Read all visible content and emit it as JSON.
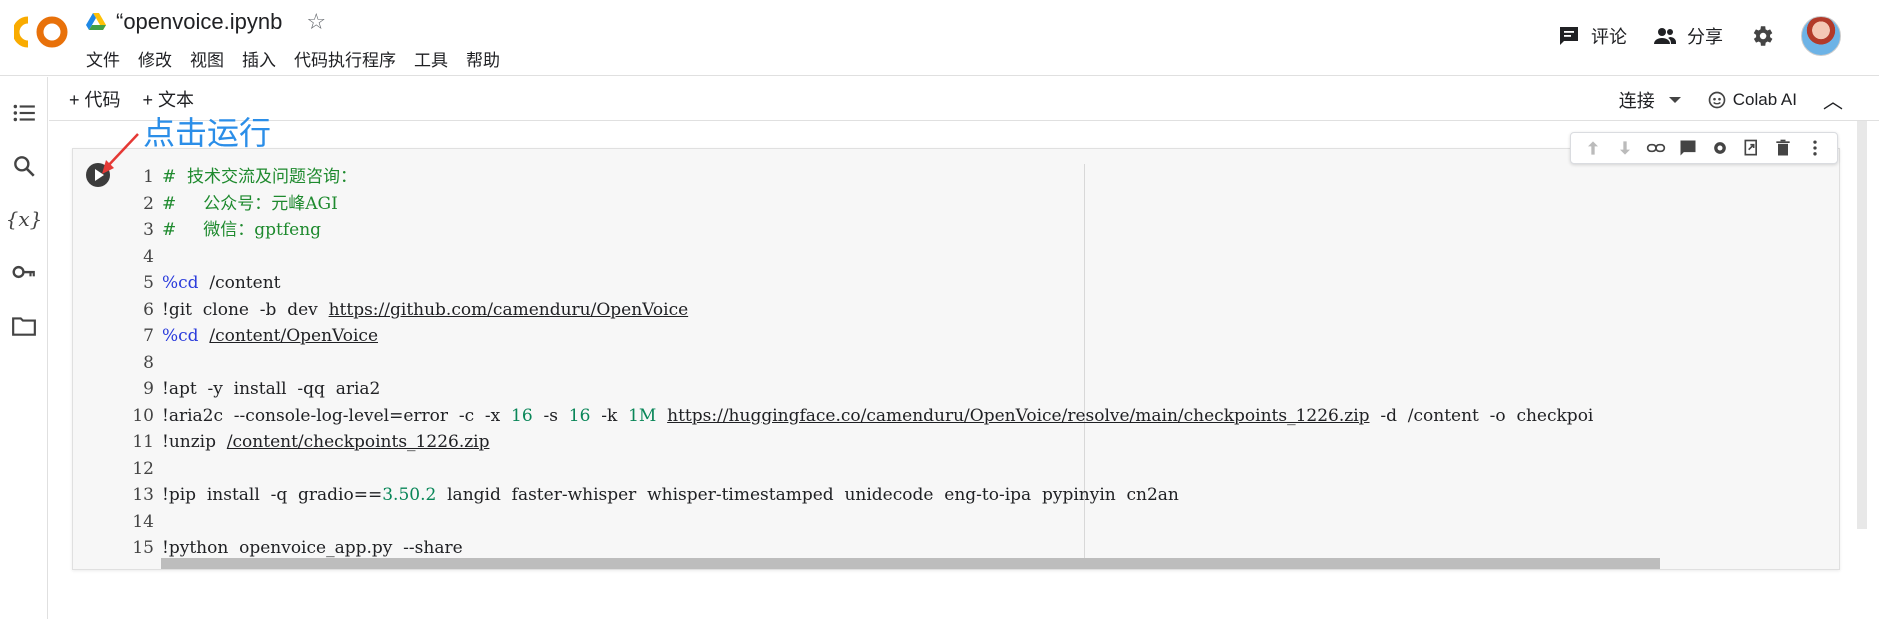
{
  "header": {
    "doc_title": "“openvoice.ipynb",
    "menu": [
      "文件",
      "修改",
      "视图",
      "插入",
      "代码执行程序",
      "工具",
      "帮助"
    ],
    "comment_label": "评论",
    "share_label": "分享"
  },
  "toolbar": {
    "add_code": "+ 代码",
    "add_text": "+ 文本",
    "connect": "连接",
    "colab_ai": "Colab AI"
  },
  "annotation": "点击运行",
  "code_lines": [
    {
      "n": "1",
      "parts": [
        {
          "t": "#  技术交流及问题咨询：",
          "c": "cm"
        }
      ]
    },
    {
      "n": "2",
      "parts": [
        {
          "t": "#     公众号：元峰AGI",
          "c": "cm"
        }
      ]
    },
    {
      "n": "3",
      "parts": [
        {
          "t": "#     微信：gptfeng",
          "c": "cm"
        }
      ]
    },
    {
      "n": "4",
      "parts": []
    },
    {
      "n": "5",
      "parts": [
        {
          "t": "%cd",
          "c": "mg"
        },
        {
          "t": "  /content",
          "c": ""
        }
      ]
    },
    {
      "n": "6",
      "parts": [
        {
          "t": "!git  clone  -b  dev  ",
          "c": ""
        },
        {
          "t": "https://github.com/camenduru/OpenVoice",
          "c": "url"
        }
      ]
    },
    {
      "n": "7",
      "parts": [
        {
          "t": "%cd",
          "c": "mg"
        },
        {
          "t": "  ",
          "c": ""
        },
        {
          "t": "/content/OpenVoice",
          "c": "url"
        }
      ]
    },
    {
      "n": "8",
      "parts": []
    },
    {
      "n": "9",
      "parts": [
        {
          "t": "!apt  -y  install  -qq  aria2",
          "c": ""
        }
      ]
    },
    {
      "n": "10",
      "parts": [
        {
          "t": "!aria2c  --console-log-level=error  -c  -x  ",
          "c": ""
        },
        {
          "t": "16",
          "c": "nm"
        },
        {
          "t": "  -s  ",
          "c": ""
        },
        {
          "t": "16",
          "c": "nm"
        },
        {
          "t": "  -k  ",
          "c": ""
        },
        {
          "t": "1M",
          "c": "nm"
        },
        {
          "t": "  ",
          "c": ""
        },
        {
          "t": "https://huggingface.co/camenduru/OpenVoice/resolve/main/checkpoints_1226.zip",
          "c": "url"
        },
        {
          "t": "  -d  /content  -o  checkpoi",
          "c": ""
        }
      ]
    },
    {
      "n": "11",
      "parts": [
        {
          "t": "!unzip  ",
          "c": ""
        },
        {
          "t": "/content/checkpoints_1226.zip",
          "c": "url"
        }
      ]
    },
    {
      "n": "12",
      "parts": []
    },
    {
      "n": "13",
      "parts": [
        {
          "t": "!pip  install  -q  gradio==",
          "c": ""
        },
        {
          "t": "3.50.2",
          "c": "nm"
        },
        {
          "t": "  langid  faster-whisper  whisper-timestamped  unidecode  eng-to-ipa  pypinyin  cn2an",
          "c": ""
        }
      ]
    },
    {
      "n": "14",
      "parts": []
    },
    {
      "n": "15",
      "parts": [
        {
          "t": "!python  openvoice_app.py  --share",
          "c": ""
        }
      ]
    }
  ]
}
